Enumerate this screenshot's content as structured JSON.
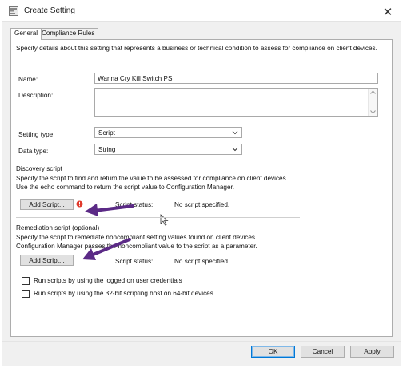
{
  "window": {
    "title": "Create Setting"
  },
  "tabs": [
    {
      "label": "General",
      "active": true
    },
    {
      "label": "Compliance Rules",
      "active": false
    }
  ],
  "general": {
    "intro": "Specify details about this setting that represents a business or technical condition to assess for compliance on client devices.",
    "name_label": "Name:",
    "name_value": "Wanna Cry Kill Switch PS",
    "description_label": "Description:",
    "description_value": "",
    "setting_type_label": "Setting type:",
    "setting_type_value": "Script",
    "data_type_label": "Data type:",
    "data_type_value": "String"
  },
  "discovery": {
    "heading": "Discovery script",
    "text": "Specify the script to find and return the value to be assessed for compliance on client devices. Use the echo command to return the script value to Configuration Manager.",
    "button": "Add Script...",
    "status_label": "Script status:",
    "status_value": "No script specified."
  },
  "remediation": {
    "heading": "Remediation script (optional)",
    "text": "Specify the script to remediate noncompliant setting values found on client devices. Configuration Manager passes the noncompliant value to the script as a parameter.",
    "button": "Add Script...",
    "status_label": "Script status:",
    "status_value": "No script specified."
  },
  "options": [
    {
      "label": "Run scripts by using the logged on user credentials",
      "checked": false
    },
    {
      "label": "Run scripts by using the 32-bit scripting host on 64-bit devices",
      "checked": false
    }
  ],
  "footer": {
    "ok": "OK",
    "cancel": "Cancel",
    "apply": "Apply"
  },
  "colors": {
    "annotation_arrow": "#5b2a86",
    "error_badge": "#e0392b"
  },
  "icons": [
    "settings-app-icon",
    "close-icon",
    "chevron-down-icon",
    "error-icon",
    "mouse-cursor-icon"
  ]
}
